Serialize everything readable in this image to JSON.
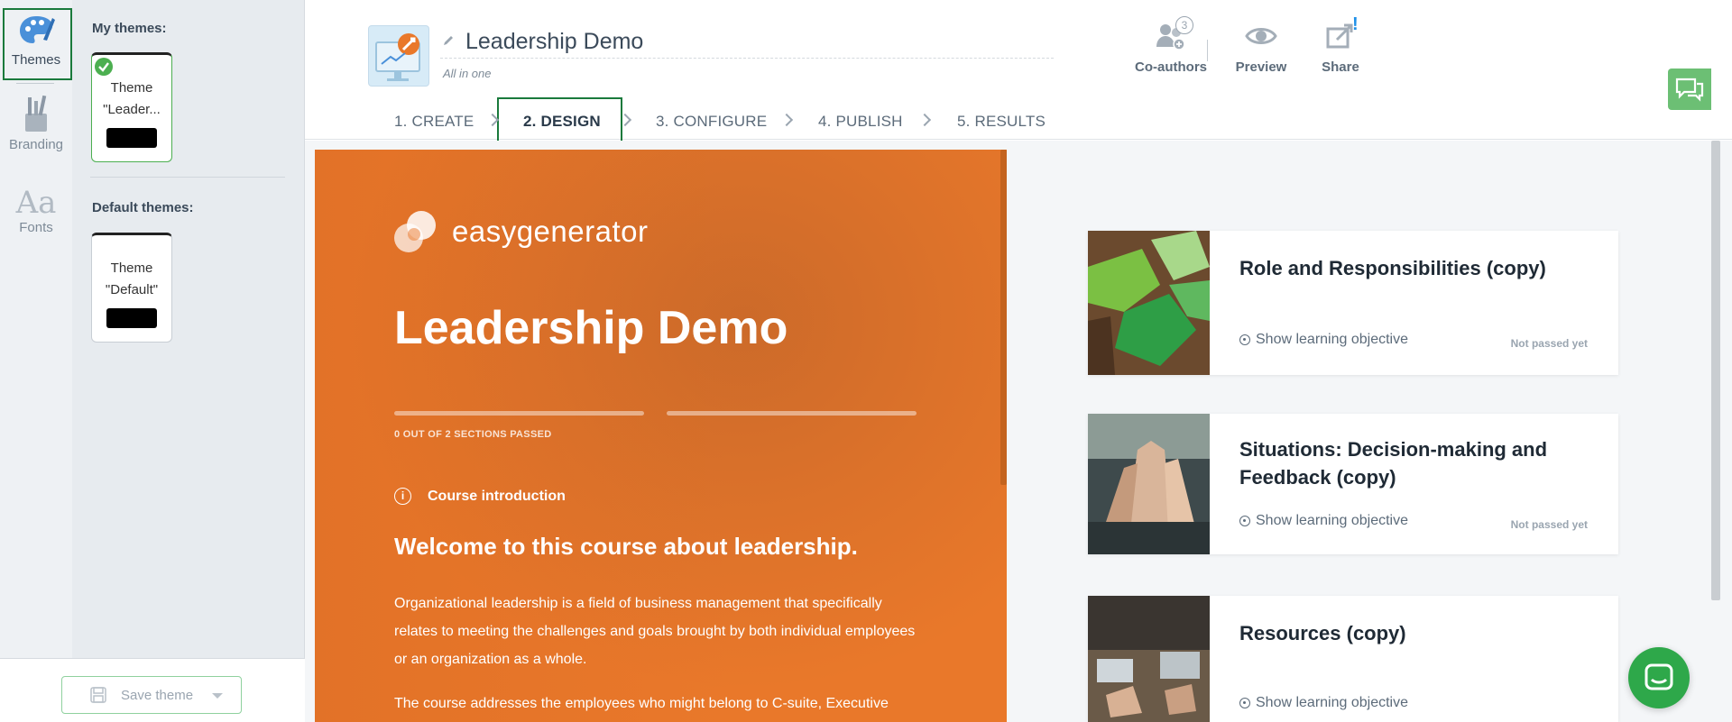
{
  "rail": {
    "items": [
      {
        "label": "Themes",
        "icon": "palette-icon"
      },
      {
        "label": "Branding",
        "icon": "brushes-icon"
      },
      {
        "label": "Fonts",
        "icon": "font-icon"
      }
    ]
  },
  "panel": {
    "my_themes_heading": "My themes:",
    "my_themes": [
      {
        "name": "Theme \"Leader...",
        "selected": true
      }
    ],
    "default_themes_heading": "Default themes:",
    "default_themes": [
      {
        "name": "Theme \"Default\"",
        "selected": false
      }
    ],
    "save_button": "Save theme"
  },
  "header": {
    "course_title": "Leadership Demo",
    "course_subtitle": "All in one",
    "coauthors_label": "Co-authors",
    "coauthors_count": "3",
    "preview_label": "Preview",
    "share_label": "Share",
    "share_alert": "!"
  },
  "steps": [
    {
      "label": "1. CREATE",
      "active": false
    },
    {
      "label": "2. DESIGN",
      "active": true
    },
    {
      "label": "3. CONFIGURE",
      "active": false
    },
    {
      "label": "4. PUBLISH",
      "active": false
    },
    {
      "label": "5. RESULTS",
      "active": false
    }
  ],
  "hero": {
    "logo_text": "easygenerator",
    "title": "Leadership Demo",
    "progress_label": "0 OUT OF 2 SECTIONS PASSED",
    "intro_label": "Course introduction",
    "welcome": "Welcome to this course about leadership.",
    "paragraph1": "Organizational leadership is a field of business management that specifically relates to meeting the challenges and goals brought by both individual employees or an organization as a whole.",
    "paragraph2": "The course addresses the employees who might belong to C-suite, Executive"
  },
  "sections": [
    {
      "title": "Role and Responsibilities (copy)",
      "objective": "Show learning objective",
      "status": "Not passed yet"
    },
    {
      "title": "Situations: Decision-making and Feedback (copy)",
      "objective": "Show learning objective",
      "status": "Not passed yet"
    },
    {
      "title": "Resources (copy)",
      "objective": "Show learning objective",
      "status": ""
    }
  ],
  "colors": {
    "accent_green": "#1a7a3c",
    "hero_orange": "#e9782a",
    "chat_green": "#2ea84a"
  }
}
